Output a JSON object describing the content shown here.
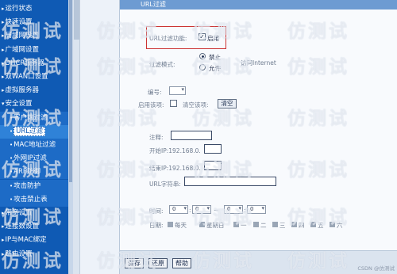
{
  "sidebar": {
    "items": [
      {
        "label": "运行状态",
        "type": "main",
        "bullet": "▸"
      },
      {
        "label": "快速设置",
        "type": "main",
        "bullet": "▸"
      },
      {
        "label": "局域网设置",
        "type": "main",
        "bullet": "▸"
      },
      {
        "label": "广域网设置",
        "type": "main",
        "bullet": "▸"
      },
      {
        "label": "DHCP服务器",
        "type": "main",
        "bullet": "▸"
      },
      {
        "label": "双WAN口设置",
        "type": "main",
        "bullet": "▸"
      },
      {
        "label": "虚拟服务器",
        "type": "main",
        "bullet": "▸"
      },
      {
        "label": "安全设置",
        "type": "main",
        "bullet": "▾"
      },
      {
        "label": "客户端过滤",
        "type": "sub",
        "bullet": "•"
      },
      {
        "label": "URL过滤",
        "type": "sub",
        "bullet": "•"
      },
      {
        "label": "MAC地址过滤",
        "type": "sub",
        "bullet": "•"
      },
      {
        "label": "外网IP过滤",
        "type": "sub",
        "bullet": "•"
      },
      {
        "label": "ARP防御",
        "type": "sub",
        "bullet": "•"
      },
      {
        "label": "攻击防护",
        "type": "sub",
        "bullet": "•"
      },
      {
        "label": "攻击禁止表",
        "type": "sub",
        "bullet": "•"
      },
      {
        "label": "带宽设置",
        "type": "main",
        "bullet": "▸"
      },
      {
        "label": "连接数设置",
        "type": "main",
        "bullet": "▸"
      },
      {
        "label": "IP与MAC绑定",
        "type": "main",
        "bullet": "▸"
      },
      {
        "label": "路由设置",
        "type": "main",
        "bullet": "▸"
      }
    ],
    "active_label": "URL过滤"
  },
  "panel": {
    "title": "URL过滤",
    "enable_label": "URL过滤功能:",
    "enable_checkbox_text": "启用",
    "enable_checked": true,
    "mode_label": "过滤模式:",
    "mode_options": [
      "禁止",
      "允许"
    ],
    "mode_selected": "禁止",
    "mode_note": "访问Internet",
    "number_label": "编号:",
    "enable_item_label": "启用该项:",
    "clear_label": "清空该项:",
    "clear_button": "清空",
    "note_label": "注释:",
    "start_ip_label": "开始IP:",
    "start_ip_prefix": "192.168.0.",
    "end_ip_label": "结束IP:",
    "end_ip_prefix": "192.168.0.",
    "url_label": "URL字符串:",
    "time_label": "时间:",
    "time_values": [
      "0",
      "0",
      "0",
      "0"
    ],
    "time_sep": ":",
    "time_range_sep": "~",
    "date_label": "日期:",
    "days": [
      "每天",
      "星期日",
      "一",
      "二",
      "三",
      "四",
      "五",
      "六"
    ]
  },
  "footer": {
    "buttons": [
      "保存",
      "还原",
      "帮助"
    ]
  },
  "watermark": "仿测试",
  "credit": "CSDN @仿测试"
}
